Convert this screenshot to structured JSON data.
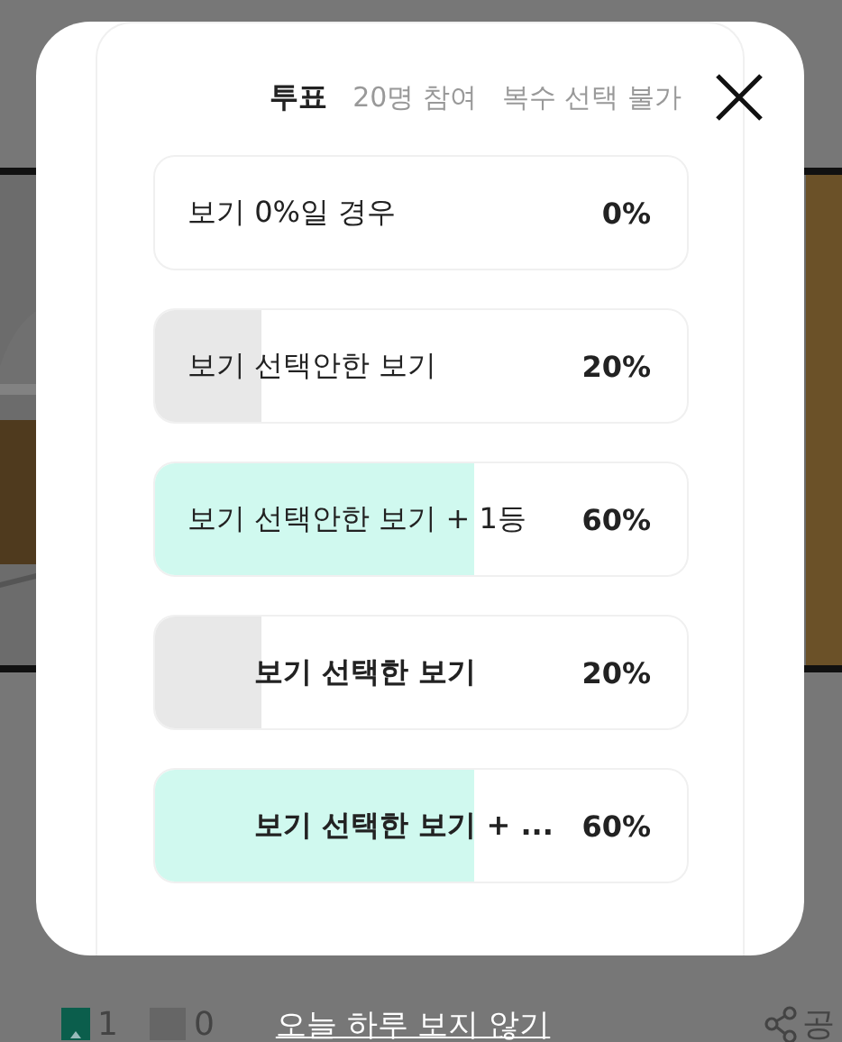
{
  "poll": {
    "title": "투표",
    "participants": "20명 참여",
    "mode": "복수 선택 불가"
  },
  "options": [
    {
      "label": "보기 0%일 경우",
      "percent": "0%",
      "selected": false
    },
    {
      "label": "보기 선택안한 보기",
      "percent": "20%",
      "level": 0.2,
      "selected": false,
      "color": "#e8e8e8"
    },
    {
      "label": "보기 선택안한 보기 + 1등",
      "percent": "60%",
      "level": 0.6,
      "selected": false,
      "color": "#d0f9ef"
    },
    {
      "label": "보기 선택한 보기",
      "percent": "20%",
      "level": 0.2,
      "selected": true,
      "color": "#e8e8e8"
    },
    {
      "label": "보기 선택한 보기 + ...",
      "percent": "60%",
      "level": 0.6,
      "selected": true,
      "color": "#d0f9ef"
    }
  ],
  "dismiss_link": "오늘 하루 보지 않기",
  "background_bar": {
    "like_count": "1",
    "dislike_count": "0",
    "share": "공"
  }
}
